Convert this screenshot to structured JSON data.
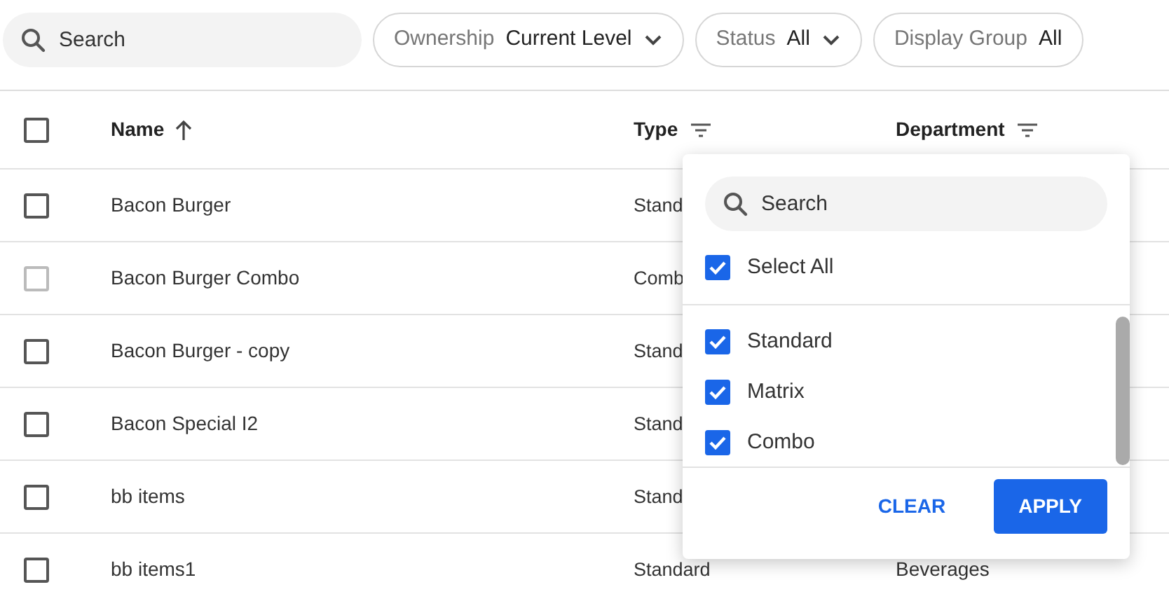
{
  "search": {
    "placeholder": "Search"
  },
  "filters": [
    {
      "label": "Ownership",
      "value": "Current Level",
      "dropdown": true
    },
    {
      "label": "Status",
      "value": "All",
      "dropdown": true
    },
    {
      "label": "Display Group",
      "value": "All",
      "dropdown": false
    }
  ],
  "table": {
    "select_all": {
      "checked": false
    },
    "columns": [
      {
        "label": "Name",
        "sorted": true,
        "filter": false
      },
      {
        "label": "Type",
        "sorted": false,
        "filter": true
      },
      {
        "label": "Department",
        "sorted": false,
        "filter": true
      }
    ],
    "rows": [
      {
        "checked": false,
        "disabled": false,
        "name": "Bacon Burger",
        "type": "Stand"
      },
      {
        "checked": false,
        "disabled": true,
        "name": "Bacon Burger Combo",
        "type": "Comb"
      },
      {
        "checked": false,
        "disabled": false,
        "name": "Bacon Burger - copy",
        "type": "Stand"
      },
      {
        "checked": false,
        "disabled": false,
        "name": "Bacon Special I2",
        "type": "Stand"
      },
      {
        "checked": false,
        "disabled": false,
        "name": "bb items",
        "type": "Stand"
      },
      {
        "checked": false,
        "disabled": false,
        "name": "bb items1",
        "type": "Standard",
        "department": "Beverages"
      }
    ]
  },
  "type_filter": {
    "search": {
      "placeholder": "Search"
    },
    "select_all": {
      "label": "Select All",
      "checked": true
    },
    "options": [
      {
        "label": "Standard",
        "checked": true
      },
      {
        "label": "Matrix",
        "checked": true
      },
      {
        "label": "Combo",
        "checked": true
      }
    ],
    "buttons": [
      {
        "label": "CLEAR",
        "kind": "text"
      },
      {
        "label": "APPLY",
        "kind": "primary"
      }
    ]
  }
}
